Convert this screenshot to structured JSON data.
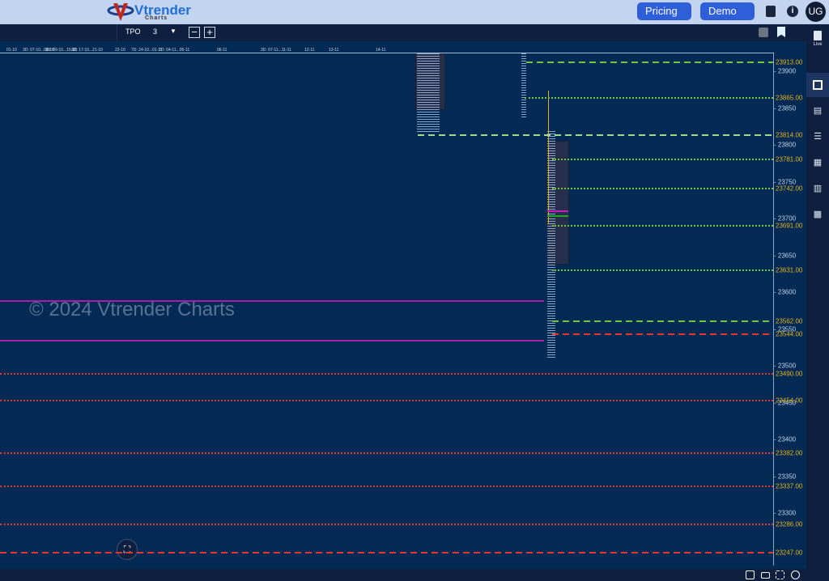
{
  "header": {
    "logo_text": "Vtrender",
    "logo_sub": "Charts",
    "pricing_label": "Pricing ₹",
    "demo_label": "Demo",
    "avatar": "UG",
    "info": "i"
  },
  "toolbar": {
    "chart_type": "TPO",
    "value": "3"
  },
  "sidebar": {
    "live_label": "Live"
  },
  "watermark": "© 2024 Vtrender Charts",
  "colors": {
    "header_bg": "#c3d4f1",
    "chart_bg": "#022a55",
    "button": "#2f5fd8",
    "level_label": "#e9b21b",
    "green": "#6cc83c",
    "red": "#e2372b",
    "magenta": "#b01aa8"
  },
  "chart_data": {
    "type": "tpo",
    "date_labels": [
      "01-10",
      "3D: 07-10...08-10",
      "3D: 09-10...15-10",
      "3D: 17-10...21-10",
      "22-10",
      "7D: 24-10...01-11",
      "2D: 04-11...05-11",
      "06-11",
      "3D: 07-11...11-11",
      "12-11",
      "13-11",
      "14-11"
    ],
    "price_ticks": [
      23900,
      23850,
      23800,
      23750,
      23700,
      23650,
      23600,
      23550,
      23500,
      23450,
      23400,
      23350,
      23300
    ],
    "ylim": [
      23240,
      23925
    ],
    "levels": [
      {
        "price": 23913,
        "label": "23913.00",
        "style": "dashed",
        "color": "green"
      },
      {
        "price": 23865,
        "label": "23865.00",
        "style": "dotted",
        "color": "green"
      },
      {
        "price": 23814,
        "label": "23814.00",
        "style": "dashed",
        "color": "lightgreen"
      },
      {
        "price": 23781,
        "label": "23781.00",
        "style": "dotted",
        "color": "green"
      },
      {
        "price": 23742,
        "label": "23742.00",
        "style": "dotted",
        "color": "green"
      },
      {
        "price": 23691,
        "label": "23691.00",
        "style": "dotted",
        "color": "green"
      },
      {
        "price": 23631,
        "label": "23631.00",
        "style": "dotted",
        "color": "green"
      },
      {
        "price": 23562,
        "label": "23562.00",
        "style": "dashed",
        "color": "green"
      },
      {
        "price": 23544,
        "label": "23544.00",
        "style": "dashed",
        "color": "red"
      },
      {
        "price": 23490,
        "label": "23490.00",
        "style": "dotted",
        "color": "red"
      },
      {
        "price": 23454,
        "label": "23454.00",
        "style": "dotted",
        "color": "red"
      },
      {
        "price": 23382,
        "label": "23382.00",
        "style": "dotted",
        "color": "red"
      },
      {
        "price": 23337,
        "label": "23337.00",
        "style": "dotted",
        "color": "red"
      },
      {
        "price": 23286,
        "label": "23286.00",
        "style": "dotted",
        "color": "red"
      },
      {
        "price": 23247,
        "label": "23247.00",
        "style": "dashed",
        "color": "red"
      }
    ],
    "magenta_lines": [
      23589,
      23535
    ]
  }
}
